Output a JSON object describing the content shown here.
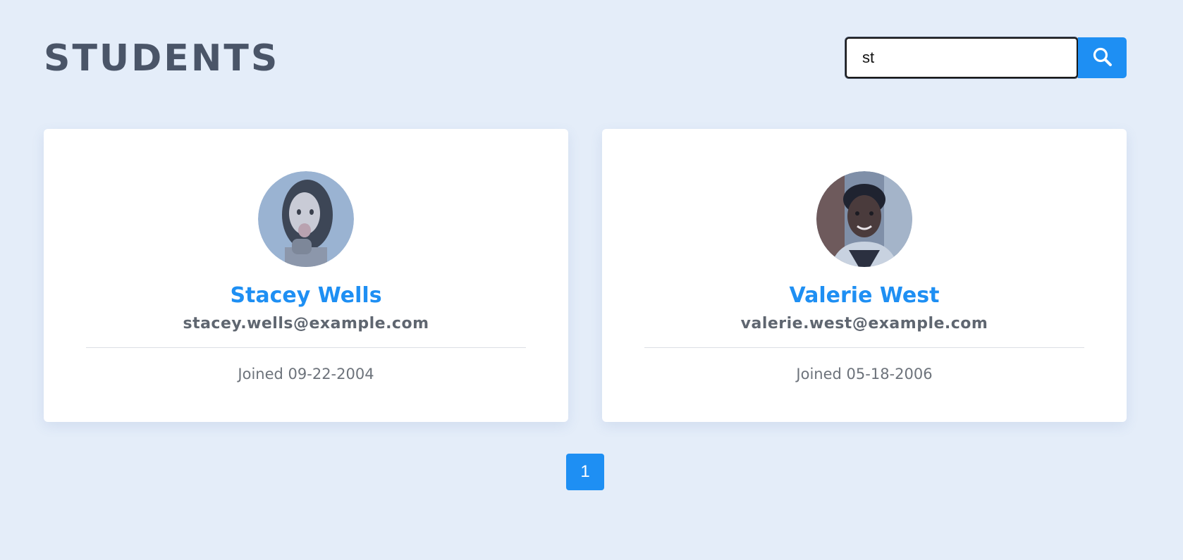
{
  "header": {
    "title": "STUDENTS"
  },
  "search": {
    "value": "st",
    "button_icon": "search-icon"
  },
  "students": [
    {
      "name": "Stacey Wells",
      "email": "stacey.wells@example.com",
      "joined": "Joined 09-22-2004",
      "avatar": "portrait-photo"
    },
    {
      "name": "Valerie West",
      "email": "valerie.west@example.com",
      "joined": "Joined 05-18-2006",
      "avatar": "portrait-photo"
    }
  ],
  "pagination": {
    "pages": [
      "1"
    ],
    "current": "1"
  },
  "colors": {
    "background": "#e4edf9",
    "accent": "#1e8ff3",
    "title": "#4a5568",
    "card": "#ffffff"
  }
}
